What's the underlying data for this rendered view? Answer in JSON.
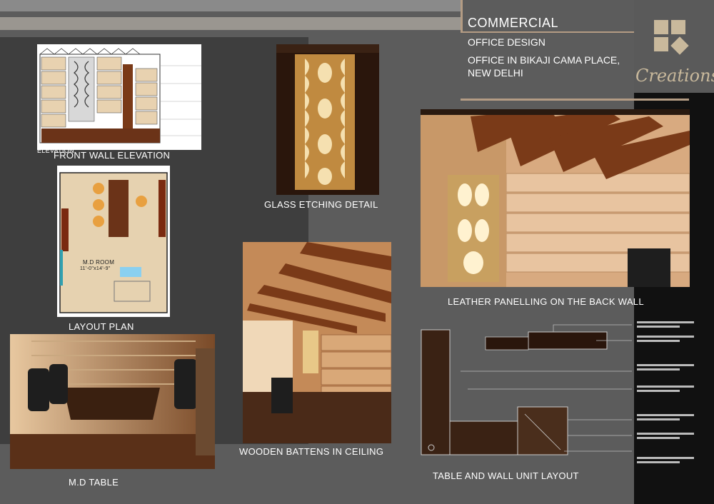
{
  "header": {
    "title": "COMMERCIAL",
    "subtitle": "OFFICE DESIGN",
    "location_line1": "OFFICE IN BIKAJI CAMA PLACE,",
    "location_line2": "NEW DELHI"
  },
  "brand": {
    "name": "Creations"
  },
  "captions": {
    "front_wall": "FRONT WALL ELEVATION",
    "layout_plan": "LAYOUT PLAN",
    "md_table": "M.D TABLE",
    "glass_etching": "GLASS ETCHING DETAIL",
    "wooden_battens": "WOODEN BATTENS IN CEILING",
    "leather_panelling": "LEATHER PANELLING ON THE BACK WALL",
    "table_wall_unit": "TABLE AND WALL UNIT LAYOUT"
  },
  "drawing_labels": {
    "elevation": "ELEVATION",
    "room_name": "M.D ROOM",
    "room_size": "11'-0\"x14'-9\""
  },
  "colors": {
    "background": "#5c5c5c",
    "accent_brown": "#b49c84",
    "wood": "#7a3a18",
    "warm_light": "#f0b070"
  }
}
